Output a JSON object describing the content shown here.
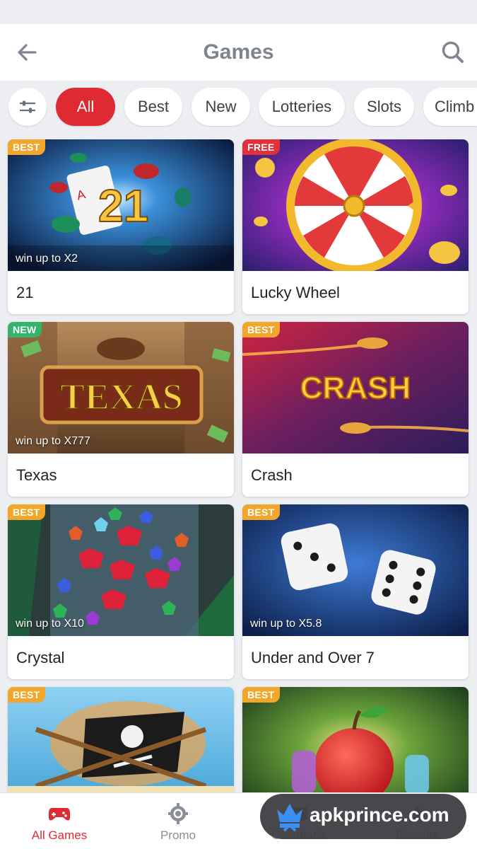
{
  "header": {
    "title": "Games"
  },
  "filters": [
    {
      "label": "All"
    },
    {
      "label": "Best"
    },
    {
      "label": "New"
    },
    {
      "label": "Lotteries"
    },
    {
      "label": "Slots"
    },
    {
      "label": "Climb"
    }
  ],
  "games": [
    {
      "name": "21",
      "badge": "BEST",
      "win": "win up to X2"
    },
    {
      "name": "Lucky Wheel",
      "badge": "FREE",
      "win": ""
    },
    {
      "name": "Texas",
      "badge": "NEW",
      "win": "win up to X777",
      "art_text": "TEXAS"
    },
    {
      "name": "Crash",
      "badge": "BEST",
      "win": "",
      "art_text": "CRASH"
    },
    {
      "name": "Crystal",
      "badge": "BEST",
      "win": "win up to X10"
    },
    {
      "name": "Under and Over 7",
      "badge": "BEST",
      "win": "win up to X5.8"
    },
    {
      "name": "",
      "badge": "BEST",
      "win": ""
    },
    {
      "name": "",
      "badge": "BEST",
      "win": ""
    }
  ],
  "bottom_nav": [
    {
      "label": "All Games",
      "icon": "gamepad-icon",
      "active": true
    },
    {
      "label": "Promo",
      "icon": "gear-icon",
      "active": false
    },
    {
      "label": "Cashback",
      "icon": "cashback-icon",
      "active": false
    },
    {
      "label": "Favorite",
      "icon": "star-icon",
      "active": false
    }
  ],
  "watermark": {
    "text": "apkprince.com"
  },
  "colors": {
    "accent": "#df2a31",
    "best": "#f3a72a",
    "free": "#e0313a",
    "new": "#34b36a"
  }
}
